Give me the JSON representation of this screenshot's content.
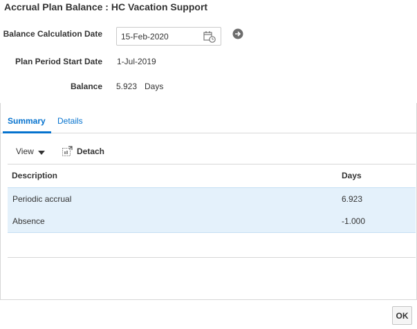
{
  "dialog": {
    "title": "Accrual Plan Balance : HC Vacation Support"
  },
  "form": {
    "balance_calc_date_label": "Balance Calculation Date",
    "balance_calc_date_value": "15-Feb-2020",
    "plan_period_start_label": "Plan Period Start Date",
    "plan_period_start_value": "1-Jul-2019",
    "balance_label": "Balance",
    "balance_value": "5.923",
    "balance_unit": "Days"
  },
  "tabs": [
    {
      "label": "Summary",
      "selected": true
    },
    {
      "label": "Details",
      "selected": false
    }
  ],
  "toolbar": {
    "view_label": "View",
    "detach_label": "Detach"
  },
  "table": {
    "columns": [
      "Description",
      "Days"
    ],
    "rows": [
      {
        "description": "Periodic accrual",
        "days": "6.923"
      },
      {
        "description": "Absence",
        "days": "-1.000"
      }
    ]
  },
  "footer": {
    "ok_label": "OK"
  },
  "colors": {
    "accent": "#0572ce",
    "row_highlight": "#e4f1fb"
  }
}
